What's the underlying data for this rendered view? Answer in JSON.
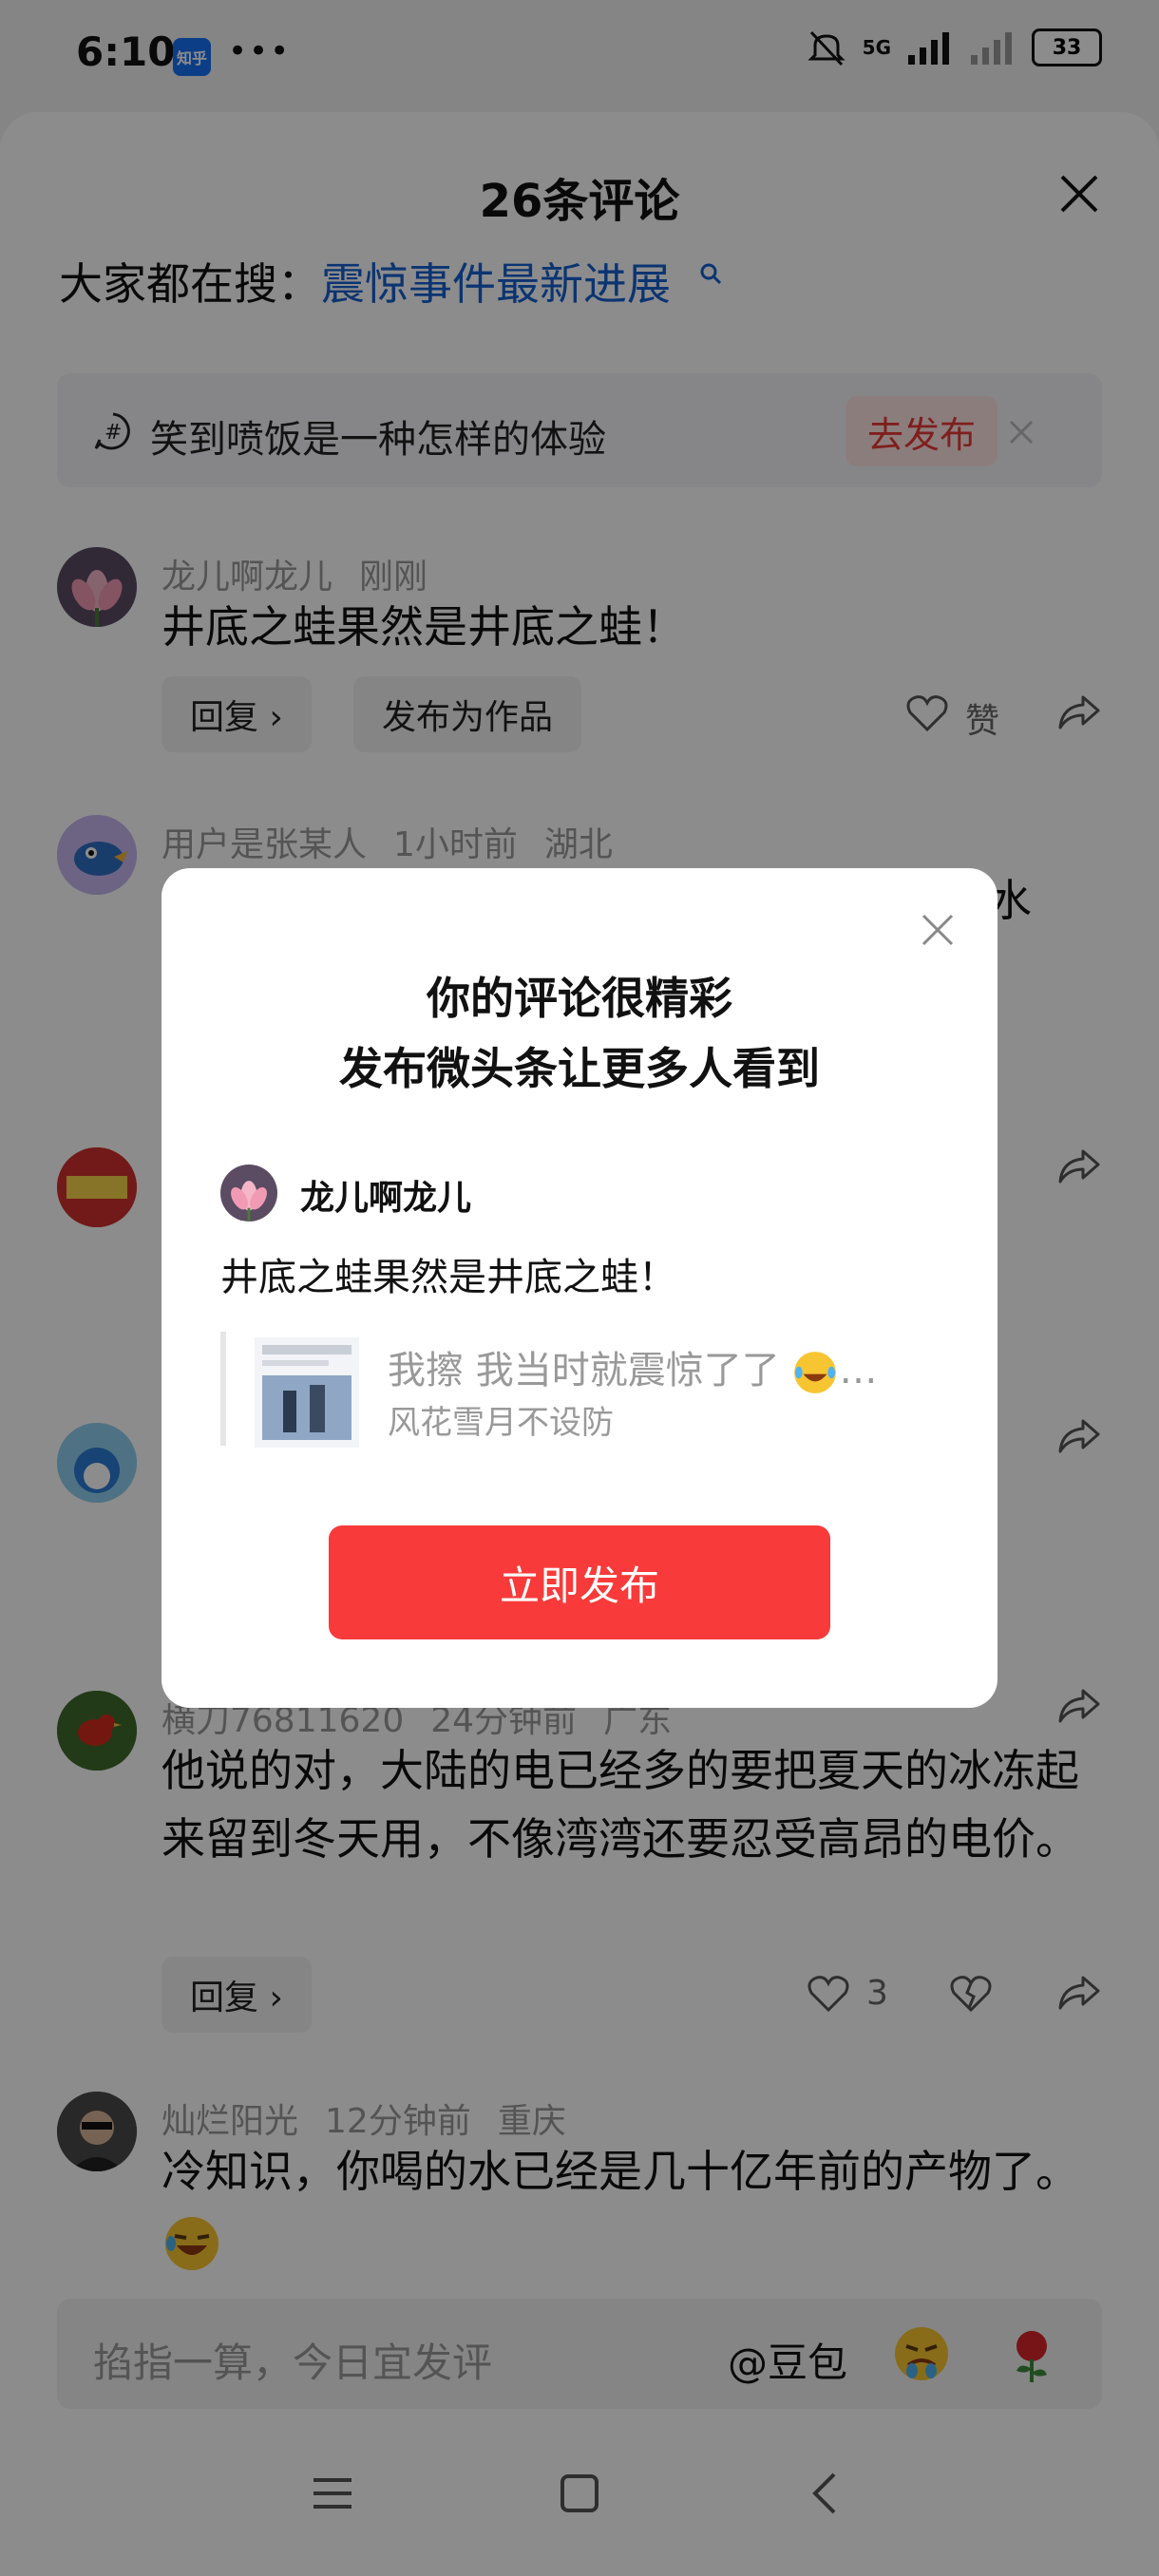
{
  "status_bar": {
    "time": "6:10",
    "app_badge": "知乎",
    "more": "•••",
    "network": "5G",
    "battery": "33"
  },
  "sheet": {
    "title": "26条评论",
    "search_prefix": "大家都在搜：",
    "search_link": "震惊事件最新进展",
    "topic": {
      "text": "笑到喷饭是一种怎样的体验",
      "button": "去发布"
    }
  },
  "comments": [
    {
      "user": "龙儿啊龙儿",
      "time": "刚刚",
      "region": "",
      "text": "井底之蛙果然是井底之蛙！",
      "reply": "回复 ›",
      "publish": "发布为作品",
      "like": "赞"
    },
    {
      "user": "用户是张某人",
      "time": "1小时前",
      "region": "湖北",
      "text_tail": "水"
    },
    {
      "user": "横刀76811620",
      "time": "24分钟前",
      "region": "广东",
      "text": "他说的对，大陆的电已经多的要把夏天的冰冻起来留到冬天用，不像湾湾还要忍受高昂的电价。",
      "reply": "回复 ›",
      "likes": "3"
    },
    {
      "user": "灿烂阳光",
      "time": "12分钟前",
      "region": "重庆",
      "text": "冷知识，你喝的水已经是几十亿年前的产物了。"
    }
  ],
  "input": {
    "placeholder": "掐指一算，今日宜发评",
    "at_label": "@豆包"
  },
  "modal": {
    "title_line1": "你的评论很精彩",
    "title_line2": "发布微头条让更多人看到",
    "user": "龙儿啊龙儿",
    "text": "井底之蛙果然是井底之蛙！",
    "quote_text": "我擦 我当时就震惊了了",
    "quote_author": "风花雪月不设防",
    "button": "立即发布"
  },
  "colors": {
    "accent_red": "#f83a3a",
    "link_blue": "#1560d0"
  }
}
